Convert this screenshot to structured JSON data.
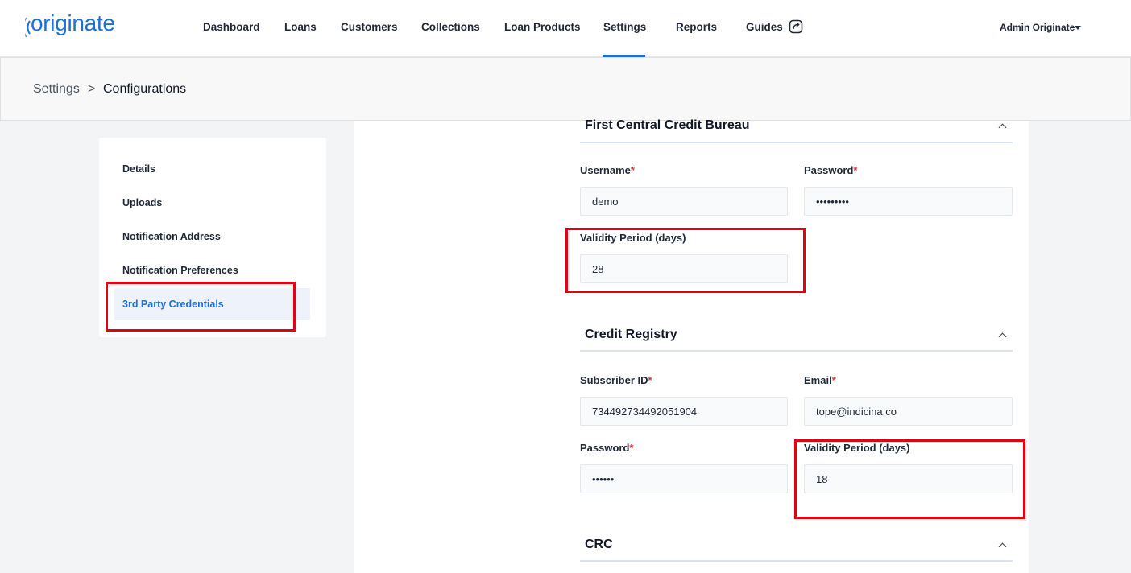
{
  "brand": {
    "logo_text": "originate",
    "color": "#1f6fd6"
  },
  "nav": {
    "items": [
      {
        "label": "Dashboard"
      },
      {
        "label": "Loans"
      },
      {
        "label": "Customers"
      },
      {
        "label": "Collections"
      },
      {
        "label": "Loan Products"
      },
      {
        "label": "Settings",
        "active": true
      },
      {
        "label": "Reports"
      },
      {
        "label": "Guides",
        "icon": "external-link-icon"
      }
    ],
    "user": {
      "label": "Admin Originate",
      "icon": "caret-down-icon"
    }
  },
  "breadcrumb": {
    "parent": "Settings",
    "separator": ">",
    "current": "Configurations"
  },
  "side_menu": {
    "items": [
      {
        "label": "Details"
      },
      {
        "label": "Uploads"
      },
      {
        "label": "Notification Address"
      },
      {
        "label": "Notification Preferences"
      },
      {
        "label": "3rd Party Credentials",
        "active": true
      }
    ]
  },
  "sections": {
    "first_central": {
      "title": "First Central Credit Bureau",
      "username": {
        "label": "Username",
        "value": "demo",
        "required": true
      },
      "password": {
        "label": "Password",
        "value": "•••••••••",
        "required": true
      },
      "validity": {
        "label": "Validity Period (days)",
        "value": "28"
      }
    },
    "credit_registry": {
      "title": "Credit Registry",
      "subscriber_id": {
        "label": "Subscriber ID",
        "value": "734492734492051904",
        "required": true
      },
      "email": {
        "label": "Email",
        "value": "tope@indicina.co",
        "required": true
      },
      "password": {
        "label": "Password",
        "value": "••••••",
        "required": true
      },
      "validity": {
        "label": "Validity Period (days)",
        "value": "18"
      }
    },
    "crc": {
      "title": "CRC"
    }
  },
  "colors": {
    "accent": "#1f6fd6",
    "required": "#d9313b",
    "highlight": "#e3000f"
  }
}
